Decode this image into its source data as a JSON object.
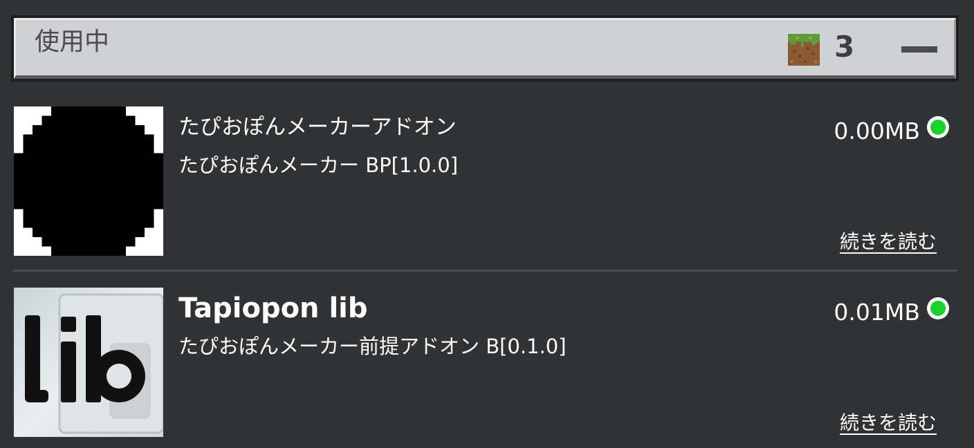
{
  "header": {
    "title": "使用中",
    "pack_count": "3",
    "pack_icon": "grass-block-icon",
    "collapse_icon": "minus-icon"
  },
  "packs": [
    {
      "name": "たぴおぽんメーカーアドオン",
      "description": "たぴおぽんメーカー BP[1.0.0]",
      "size": "0.00MB",
      "status_color": "#19d22b",
      "read_more": "続きを読む",
      "thumbnail": "black-circle-pixel-icon"
    },
    {
      "name": "Tapiopon lib",
      "description": "たぴおぽんメーカー前提アドオン B[0.1.0]",
      "size": "0.01MB",
      "status_color": "#19d22b",
      "read_more": "続きを読む",
      "thumbnail": "lib-text-icon"
    }
  ],
  "colors": {
    "background": "#313233",
    "header_bg": "#d0d1d4",
    "status_green": "#19d22b"
  }
}
